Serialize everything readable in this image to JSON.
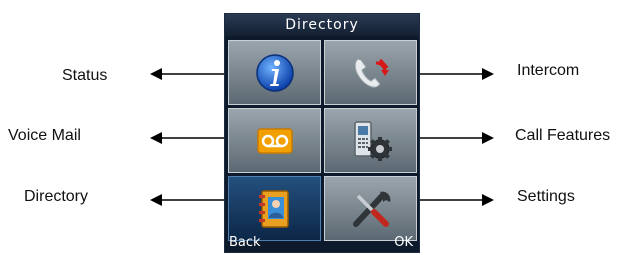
{
  "screen": {
    "title": "Directory",
    "softkeys": {
      "left": "Back",
      "right": "OK"
    },
    "tiles": [
      {
        "label": "Status",
        "icon": "info-icon",
        "selected": false
      },
      {
        "label": "Intercom",
        "icon": "intercom-phone-icon",
        "selected": false
      },
      {
        "label": "Voice Mail",
        "icon": "voicemail-icon",
        "selected": false
      },
      {
        "label": "Call Features",
        "icon": "call-features-icon",
        "selected": false
      },
      {
        "label": "Directory",
        "icon": "directory-book-icon",
        "selected": true
      },
      {
        "label": "Settings",
        "icon": "settings-tools-icon",
        "selected": false
      }
    ]
  },
  "callouts": {
    "status": "Status",
    "intercom": "Intercom",
    "voice_mail": "Voice Mail",
    "call_features": "Call Features",
    "directory": "Directory",
    "settings": "Settings"
  },
  "colors": {
    "screen_bg": "#0d1a2b",
    "tile_gray": "#7c8790",
    "tile_selected": "#1a3d66",
    "accent_orange": "#f0a400"
  }
}
